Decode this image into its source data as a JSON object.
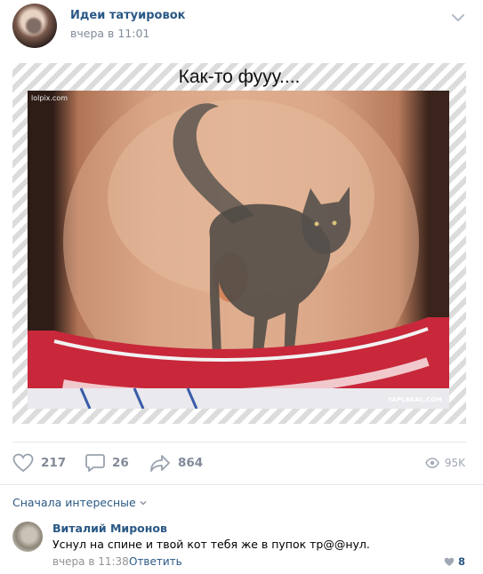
{
  "post": {
    "author": "Идеи татуировок",
    "time": "вчера в 11:01",
    "caption": "Как-то фууу....",
    "watermarks": [
      "lolpix.com",
      "YAPLAKAL.COM"
    ],
    "stats": {
      "likes": "217",
      "comments": "26",
      "shares": "864",
      "views": "95K"
    }
  },
  "comments_section": {
    "sort_label": "Сначала интересные",
    "comment": {
      "author": "Виталий Миронов",
      "text": "Уснул на спине и твой кот тебя же в пупок тр@@нул.",
      "time": "вчера в 11:38",
      "reply_label": "Ответить",
      "likes": "8"
    }
  },
  "colors": {
    "link": "#2a5885",
    "muted": "#818c99",
    "divider": "#e7e8ec"
  },
  "icons": [
    "chevron-down-icon",
    "heart-icon",
    "comment-icon",
    "share-icon",
    "eye-icon"
  ]
}
